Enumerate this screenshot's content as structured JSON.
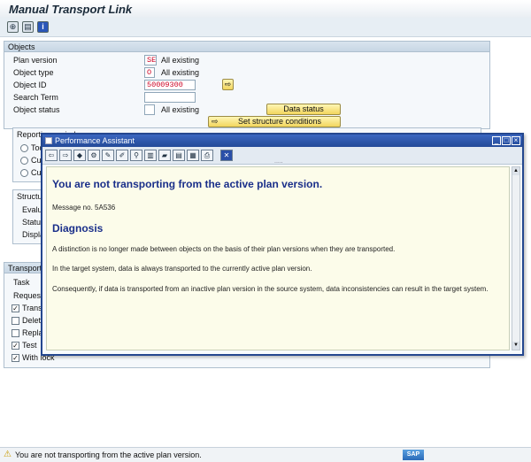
{
  "window": {
    "title": "Manual Transport Link"
  },
  "toolbar": {
    "icons": [
      "execute-icon",
      "variant-icon",
      "info-icon"
    ]
  },
  "objects": {
    "header": "Objects",
    "plan_version_label": "Plan version",
    "plan_version_value": "SE",
    "plan_version_desc": "All existing",
    "object_type_label": "Object type",
    "object_type_value": "O",
    "object_type_desc": "All existing",
    "object_id_label": "Object ID",
    "object_id_value": "50009300",
    "search_term_label": "Search Term",
    "object_status_label": "Object status",
    "object_status_desc": "All existing",
    "data_status_button": "Data status",
    "set_structure_button": "Set structure conditions"
  },
  "reporting": {
    "header": "Reporting period",
    "options": [
      "Tod",
      "Cur",
      "Cur"
    ]
  },
  "structure": {
    "header": "Structur",
    "rows": [
      "Evalua",
      "Status",
      "Displa"
    ]
  },
  "transport": {
    "header": "Transport",
    "task_label": "Task",
    "request_label": "Request",
    "checks": [
      {
        "label": "Transp",
        "checked": true
      },
      {
        "label": "Delete",
        "checked": false
      },
      {
        "label": "Replac",
        "checked": false
      },
      {
        "label": "Test",
        "checked": true
      },
      {
        "label": "With lock",
        "checked": true
      }
    ]
  },
  "popup": {
    "title": "Performance Assistant",
    "heading": "You are not transporting from the active plan version.",
    "message_no": "Message no. 5A536",
    "diagnosis_heading": "Diagnosis",
    "paragraphs": [
      "A distinction is no longer made between objects on the basis of their plan versions when they are transported.",
      "In the target system, data is always transported to the currently active plan version.",
      "Consequently, if data is transported from an inactive plan version in the source system, data inconsistencies can result in the target system."
    ],
    "drag_handle": "....."
  },
  "status": {
    "message": "You are not transporting from the active plan version.",
    "brand": "SAP"
  }
}
